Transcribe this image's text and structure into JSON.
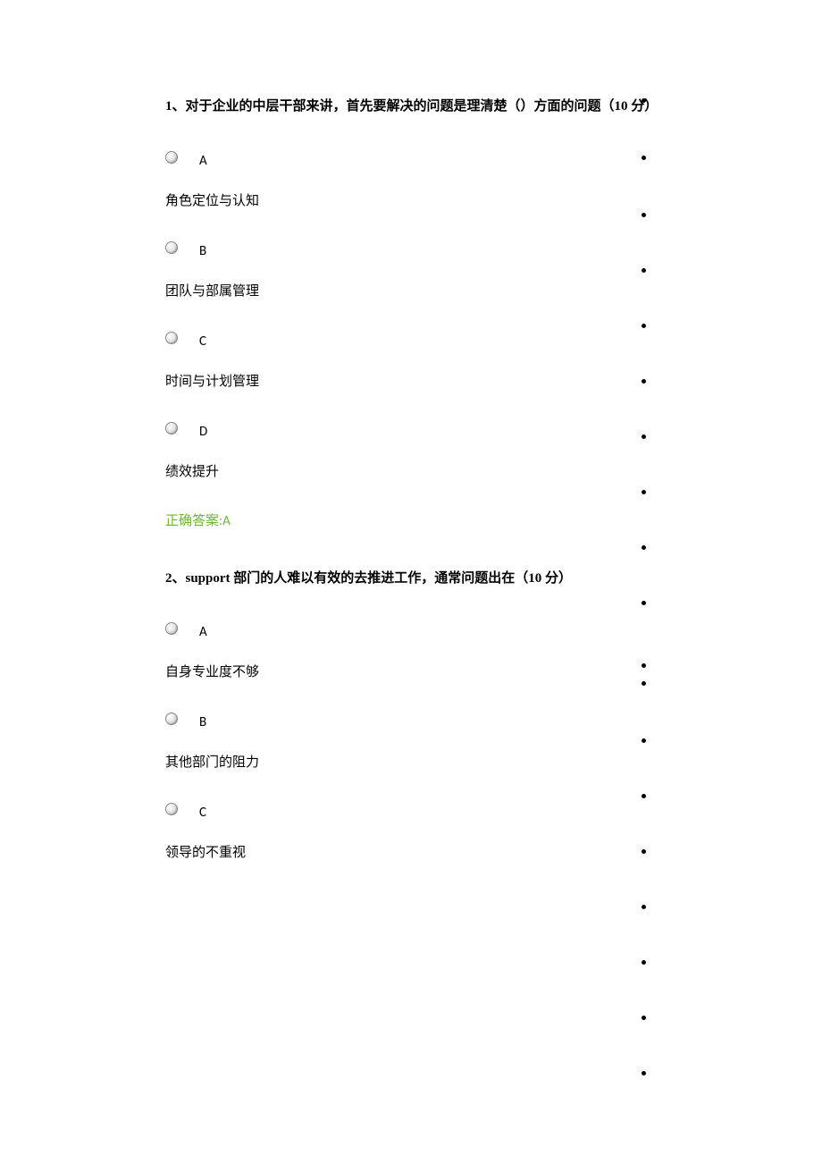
{
  "q1": {
    "stem": "1、对于企业的中层干部来讲，首先要解决的问题是理清楚（）方面的问题（10 分）",
    "opts": {
      "A": {
        "letter": "A",
        "text": "角色定位与认知"
      },
      "B": {
        "letter": "B",
        "text": "团队与部属管理"
      },
      "C": {
        "letter": "C",
        "text": "时间与计划管理"
      },
      "D": {
        "letter": "D",
        "text": "绩效提升"
      }
    },
    "ans_label": "正确答案:",
    "ans_letter": "A"
  },
  "q2": {
    "stem": "2、support 部门的人难以有效的去推进工作，通常问题出在（10 分）",
    "opts": {
      "A": {
        "letter": "A",
        "text": "自身专业度不够"
      },
      "B": {
        "letter": "B",
        "text": "其他部门的阻力"
      },
      "C": {
        "letter": "C",
        "text": "领导的不重视"
      }
    }
  }
}
